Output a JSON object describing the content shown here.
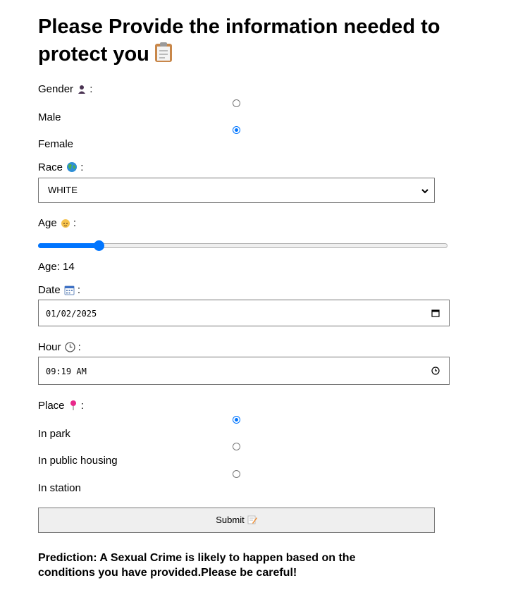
{
  "title": "Please Provide the information needed to protect you",
  "gender": {
    "label": "Gender",
    "icon": "person-icon",
    "options": [
      {
        "label": "Male",
        "checked": false
      },
      {
        "label": "Female",
        "checked": true
      }
    ]
  },
  "race": {
    "label": "Race",
    "icon": "globe-icon",
    "selected": "WHITE"
  },
  "age": {
    "label": "Age",
    "icon": "baby-icon",
    "value": 14,
    "display": "Age: 14",
    "slider_fraction": 0.14
  },
  "date": {
    "label": "Date",
    "icon": "calendar-icon",
    "value": "01/02/2025"
  },
  "hour": {
    "label": "Hour",
    "icon": "clock-icon",
    "value": "09:19 AM"
  },
  "place": {
    "label": "Place",
    "icon": "pushpin-icon",
    "options": [
      {
        "label": "In park",
        "checked": true
      },
      {
        "label": "In public housing",
        "checked": false
      },
      {
        "label": "In station",
        "checked": false
      }
    ]
  },
  "submit": {
    "label": "Submit",
    "icon": "memo-icon"
  },
  "prediction": "Prediction: A Sexual Crime is likely to happen based on the conditions you have provided.Please be careful!",
  "colors": {
    "accent": "#0075ff",
    "button_bg": "#efefef",
    "border": "#767676"
  }
}
